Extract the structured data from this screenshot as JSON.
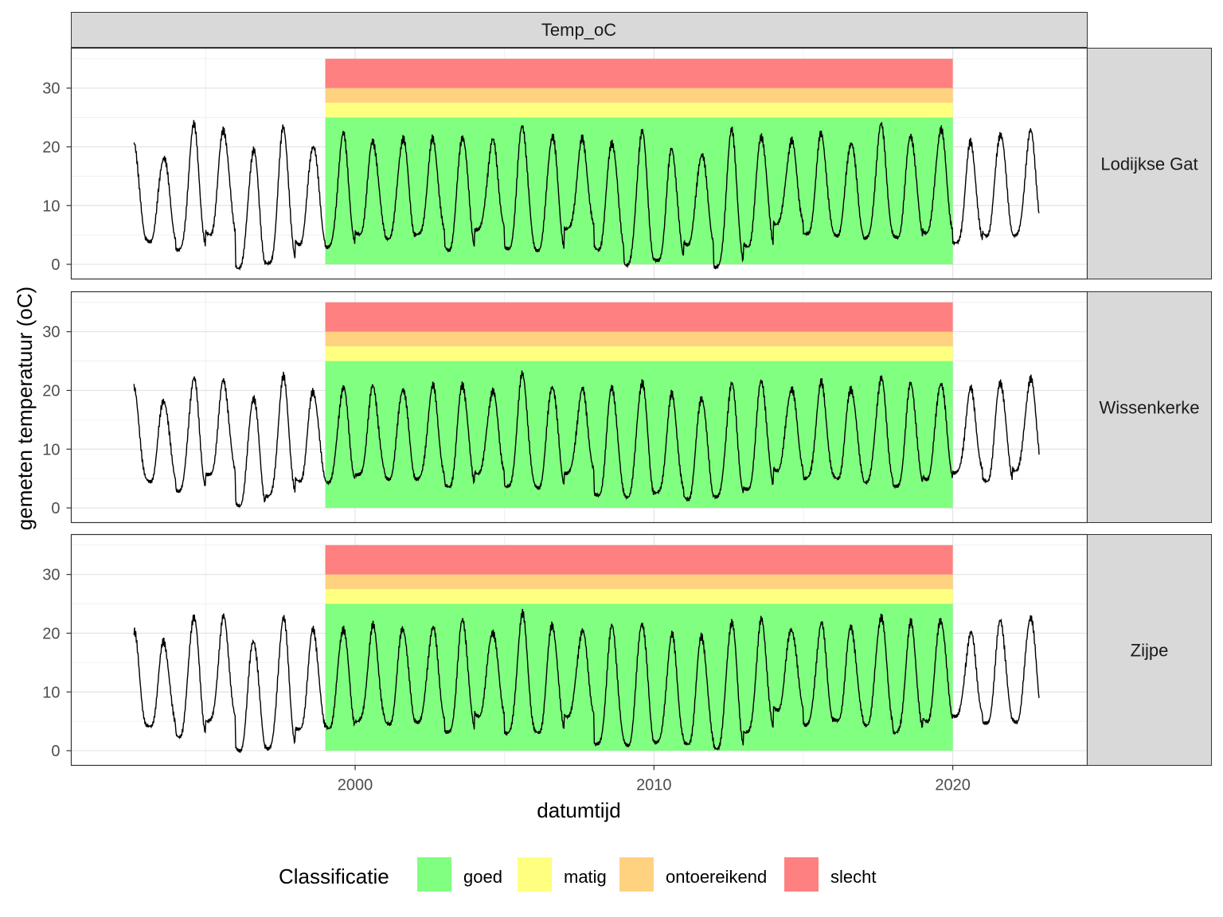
{
  "chart_data": {
    "type": "line",
    "facet_column_label": "Temp_oC",
    "xlabel": "datumtijd",
    "ylabel": "gemeten temperatuur (oC)",
    "x_ticks": [
      2000,
      2010,
      2020
    ],
    "y_ticks": [
      0,
      10,
      20,
      30
    ],
    "xlim": [
      1990.5,
      2024.5
    ],
    "ylim": [
      -2.5,
      36.8
    ],
    "grid": true,
    "legend": {
      "title": "Classificatie",
      "placement": "bottom",
      "entries": [
        {
          "label": "goed",
          "color": "#80ff80"
        },
        {
          "label": "matig",
          "color": "#ffff80"
        },
        {
          "label": "ontoereikend",
          "color": "#ffd280"
        },
        {
          "label": "slecht",
          "color": "#ff8080"
        }
      ]
    },
    "classification_bands": {
      "x_range": [
        1999.0,
        2020.0
      ],
      "bands": [
        {
          "class": "goed",
          "ymin": 0,
          "ymax": 25
        },
        {
          "class": "matig",
          "ymin": 25,
          "ymax": 27.5
        },
        {
          "class": "ontoereikend",
          "ymin": 27.5,
          "ymax": 30
        },
        {
          "class": "slecht",
          "ymin": 30,
          "ymax": 35
        }
      ]
    },
    "series_structure": {
      "x_start": 1992.6,
      "x_end": 2022.9,
      "peak_fraction_of_year": 0.6,
      "trough_fraction_of_year": 0.12
    },
    "panels": [
      {
        "label": "Lodijkse Gat",
        "years": [
          1992.6,
          2022.9
        ],
        "annual_min": [
          3.5,
          4.0,
          2.5,
          5.0,
          -0.5,
          0.0,
          3.5,
          3.0,
          5.0,
          4.5,
          5.0,
          2.5,
          6.0,
          2.5,
          2.5,
          6.0,
          2.5,
          0.0,
          0.5,
          3.5,
          -0.5,
          3.0,
          7.0,
          5.0,
          5.0,
          4.5,
          4.5,
          5.5,
          3.5,
          5.0,
          5.0
        ],
        "annual_max": [
          20.5,
          18.5,
          23.5,
          23.0,
          19.5,
          23.0,
          20.5,
          22.0,
          21.0,
          21.5,
          21.0,
          22.0,
          21.0,
          23.5,
          22.0,
          21.0,
          21.0,
          22.5,
          19.5,
          19.0,
          22.5,
          22.0,
          21.0,
          22.0,
          21.0,
          23.5,
          22.0,
          23.0,
          20.5,
          22.5,
          22.5
        ]
      },
      {
        "label": "Wissenkerke",
        "years": [
          1992.6,
          2022.9
        ],
        "annual_min": [
          4.5,
          4.5,
          3.0,
          5.5,
          0.5,
          2.0,
          4.5,
          4.5,
          5.5,
          5.0,
          5.0,
          3.5,
          6.0,
          3.5,
          3.5,
          6.0,
          2.0,
          2.0,
          2.5,
          1.5,
          2.0,
          3.0,
          6.5,
          5.0,
          5.0,
          4.5,
          3.5,
          5.0,
          6.0,
          4.5,
          6.5
        ],
        "annual_max": [
          20.0,
          18.5,
          22.0,
          21.5,
          19.0,
          22.0,
          20.0,
          20.5,
          20.5,
          20.5,
          20.5,
          21.0,
          20.0,
          22.5,
          21.0,
          20.0,
          20.5,
          21.5,
          19.0,
          19.0,
          21.0,
          21.5,
          20.5,
          21.0,
          20.5,
          22.0,
          21.0,
          21.5,
          20.0,
          21.5,
          22.0
        ]
      },
      {
        "label": "Zijpe",
        "years": [
          1992.6,
          2022.9
        ],
        "annual_min": [
          4.0,
          4.0,
          2.5,
          5.0,
          0.0,
          0.5,
          3.5,
          4.0,
          5.0,
          4.5,
          5.0,
          3.0,
          6.0,
          3.0,
          3.0,
          6.0,
          1.0,
          1.0,
          1.5,
          1.0,
          0.5,
          3.0,
          7.0,
          4.5,
          5.0,
          4.5,
          3.0,
          5.0,
          6.0,
          4.5,
          5.0
        ],
        "annual_max": [
          20.0,
          18.5,
          23.0,
          22.5,
          19.0,
          22.5,
          20.5,
          21.0,
          21.0,
          21.0,
          21.0,
          22.0,
          20.5,
          23.0,
          21.5,
          20.5,
          21.0,
          22.0,
          19.5,
          19.5,
          22.0,
          22.0,
          21.0,
          21.5,
          21.0,
          23.0,
          21.5,
          22.5,
          20.0,
          22.0,
          23.0
        ]
      }
    ]
  }
}
